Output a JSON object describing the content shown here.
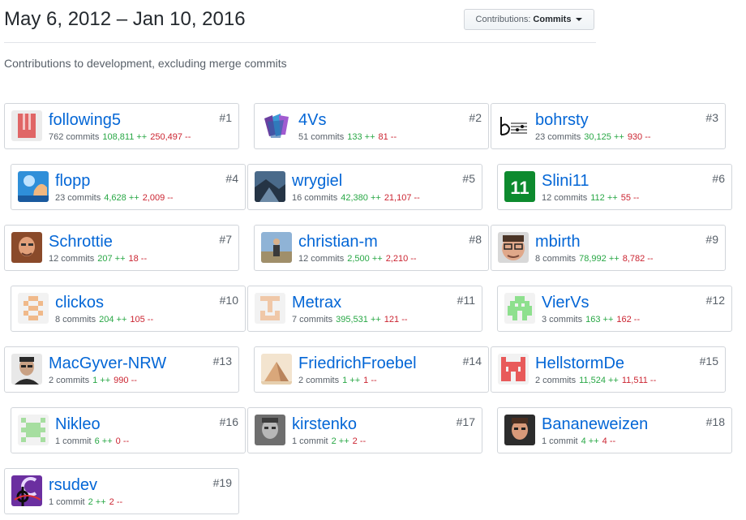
{
  "header": {
    "range": "May 6, 2012 – Jan 10, 2016",
    "select_label": "Contributions:",
    "select_value": "Commits"
  },
  "subtitle": "Contributions to development, excluding merge commits",
  "contributors": [
    {
      "rank": "#1",
      "login": "following5",
      "commits": "762 commits",
      "additions": "108,811 ++",
      "deletions": "250,497 --"
    },
    {
      "rank": "#2",
      "login": "4Vs",
      "commits": "51 commits",
      "additions": "133 ++",
      "deletions": "81 --"
    },
    {
      "rank": "#3",
      "login": "bohrsty",
      "commits": "23 commits",
      "additions": "30,125 ++",
      "deletions": "930 --"
    },
    {
      "rank": "#4",
      "login": "flopp",
      "commits": "23 commits",
      "additions": "4,628 ++",
      "deletions": "2,009 --"
    },
    {
      "rank": "#5",
      "login": "wrygiel",
      "commits": "16 commits",
      "additions": "42,380 ++",
      "deletions": "21,107 --"
    },
    {
      "rank": "#6",
      "login": "Slini11",
      "commits": "12 commits",
      "additions": "112 ++",
      "deletions": "55 --"
    },
    {
      "rank": "#7",
      "login": "Schrottie",
      "commits": "12 commits",
      "additions": "207 ++",
      "deletions": "18 --"
    },
    {
      "rank": "#8",
      "login": "christian-m",
      "commits": "12 commits",
      "additions": "2,500 ++",
      "deletions": "2,210 --"
    },
    {
      "rank": "#9",
      "login": "mbirth",
      "commits": "8 commits",
      "additions": "78,992 ++",
      "deletions": "8,782 --"
    },
    {
      "rank": "#10",
      "login": "clickos",
      "commits": "8 commits",
      "additions": "204 ++",
      "deletions": "105 --"
    },
    {
      "rank": "#11",
      "login": "Metrax",
      "commits": "7 commits",
      "additions": "395,531 ++",
      "deletions": "121 --"
    },
    {
      "rank": "#12",
      "login": "VierVs",
      "commits": "3 commits",
      "additions": "163 ++",
      "deletions": "162 --"
    },
    {
      "rank": "#13",
      "login": "MacGyver-NRW",
      "commits": "2 commits",
      "additions": "1 ++",
      "deletions": "990 --"
    },
    {
      "rank": "#14",
      "login": "FriedrichFroebel",
      "commits": "2 commits",
      "additions": "1 ++",
      "deletions": "1 --"
    },
    {
      "rank": "#15",
      "login": "HellstormDe",
      "commits": "2 commits",
      "additions": "11,524 ++",
      "deletions": "11,511 --"
    },
    {
      "rank": "#16",
      "login": "Nikleo",
      "commits": "1 commit",
      "additions": "6 ++",
      "deletions": "0 --"
    },
    {
      "rank": "#17",
      "login": "kirstenko",
      "commits": "1 commit",
      "additions": "2 ++",
      "deletions": "2 --"
    },
    {
      "rank": "#18",
      "login": "Bananeweizen",
      "commits": "1 commit",
      "additions": "4 ++",
      "deletions": "4 --"
    },
    {
      "rank": "#19",
      "login": "rsudev",
      "commits": "1 commit",
      "additions": "2 ++",
      "deletions": "2 --"
    }
  ],
  "avatar_text": {
    "slini11": "11"
  },
  "colors": {
    "link": "#0366d6",
    "additions": "#28a745",
    "deletions": "#cb2431"
  }
}
